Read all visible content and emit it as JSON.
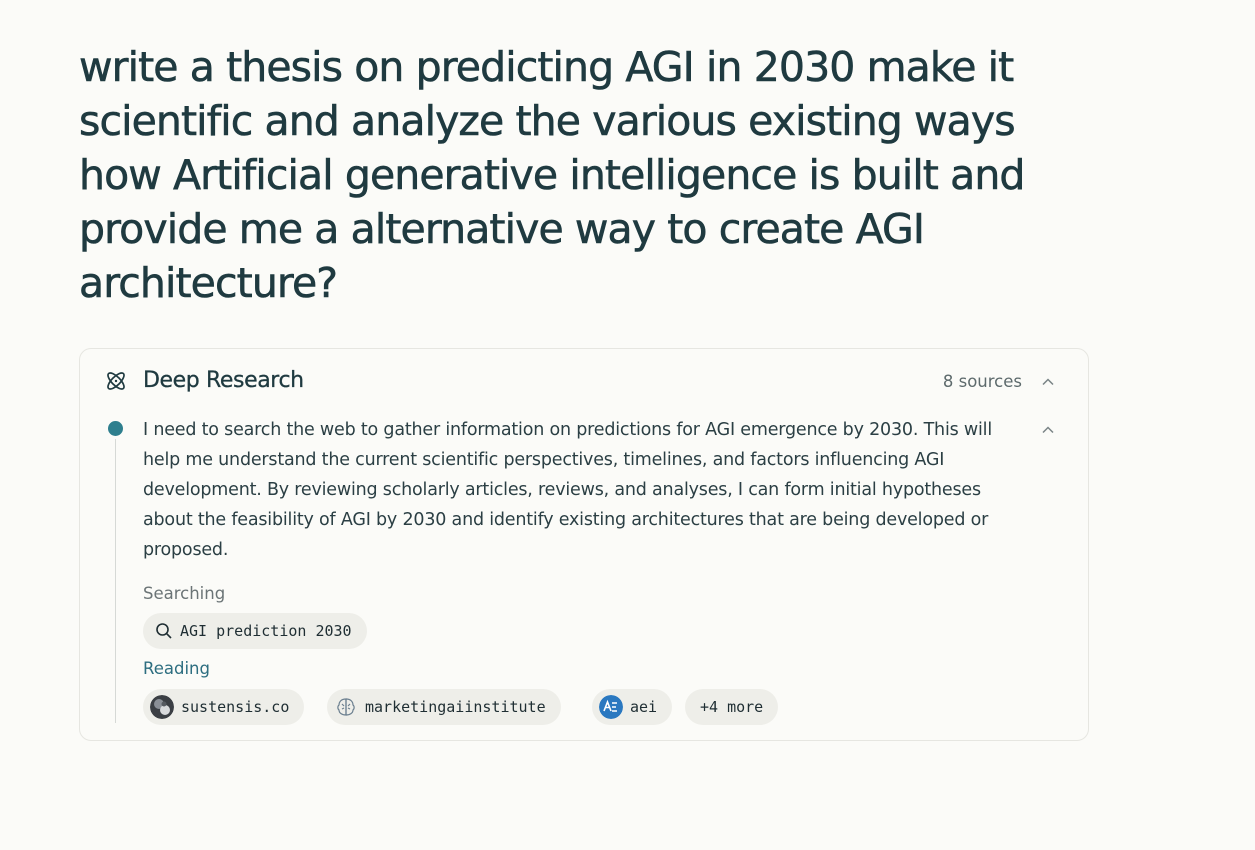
{
  "query": "write a thesis on predicting AGI in 2030 make it scientific and analyze the various existing ways how Artificial generative intelligence is built and provide me a alternative way to create AGI architecture?",
  "research": {
    "title": "Deep Research",
    "sources_count": "8 sources",
    "step": {
      "text": "I need to search the web to gather information on predictions for AGI emergence by 2030. This will help me understand the current scientific perspectives, timelines, and factors influencing AGI development. By reviewing scholarly articles, reviews, and analyses, I can form initial hypotheses about the feasibility of AGI by 2030 and identify existing architectures that are being developed or proposed.",
      "searching_label": "Searching",
      "search_query": "AGI prediction 2030",
      "reading_label": "Reading",
      "sources": [
        {
          "name": "sustensis.co",
          "icon": "sustensis-favicon"
        },
        {
          "name": "marketingaiinstitute",
          "icon": "brain-favicon"
        },
        {
          "name": "aei",
          "icon": "aei-favicon"
        }
      ],
      "more_label": "+4 more"
    }
  },
  "colors": {
    "background": "#fbfbf8",
    "text": "#1f3a40",
    "accent": "#2e7f8e",
    "reading": "#2d6e80",
    "pill": "#eeeee9"
  }
}
